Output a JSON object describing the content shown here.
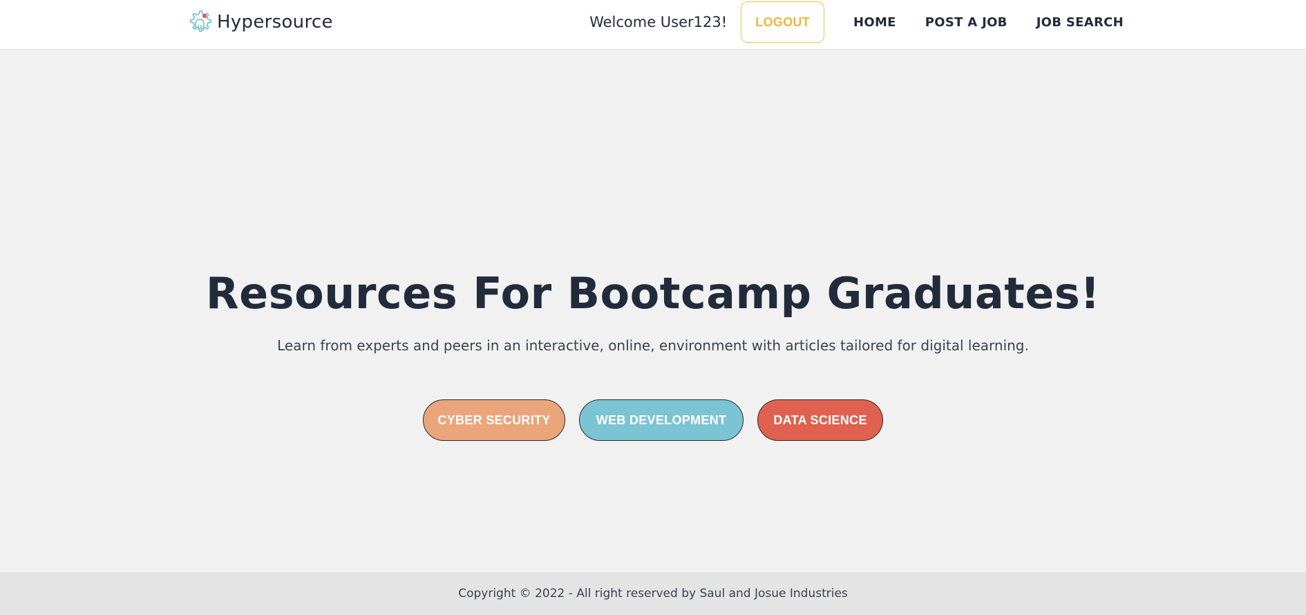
{
  "navbar": {
    "brand": {
      "name": "Hypersource",
      "icon": "hypersource-logo-icon"
    },
    "welcome_text": "Welcome User123!",
    "logout_label": "LOGOUT",
    "links": [
      {
        "label": "HOME"
      },
      {
        "label": "POST A JOB"
      },
      {
        "label": "JOB SEARCH"
      }
    ]
  },
  "hero": {
    "title": "Resources For Bootcamp Graduates!",
    "subtitle": "Learn from experts and peers in an interactive, online, environment with articles tailored for digital learning.",
    "categories": [
      {
        "label": "CYBER SECURITY",
        "color": "#eba57b"
      },
      {
        "label": "WEB DEVELOPMENT",
        "color": "#7bc4d3"
      },
      {
        "label": "DATA SCIENCE",
        "color": "#e06150"
      }
    ]
  },
  "footer": {
    "copyright": "Copyright © 2022 - All right reserved by Saul and Josue Industries"
  },
  "colors": {
    "text_dark": "#212b3b",
    "logout_accent": "#f2b33d",
    "page_bg": "#f1f1f1",
    "navbar_bg": "#ffffff",
    "footer_bg": "#e4e4e4"
  }
}
